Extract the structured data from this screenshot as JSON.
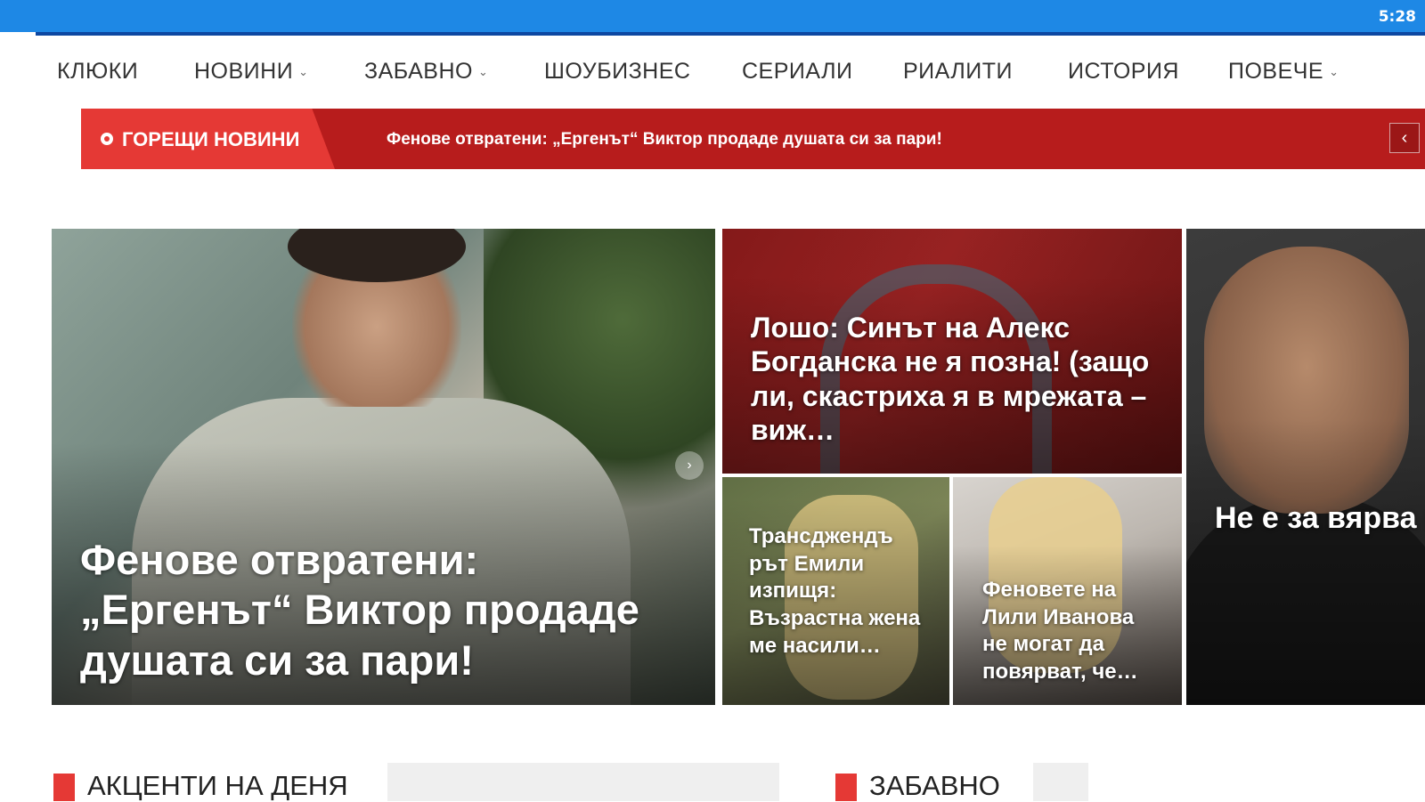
{
  "status_bar": {
    "time": "5:28",
    "color": "#1e88e5"
  },
  "nav": {
    "items": [
      {
        "label": "КЛЮКИ",
        "dropdown": false
      },
      {
        "label": "НОВИНИ",
        "dropdown": true
      },
      {
        "label": "ЗАБАВНО",
        "dropdown": true
      },
      {
        "label": "ШОУБИЗНЕС",
        "dropdown": false
      },
      {
        "label": "СЕРИАЛИ",
        "dropdown": false
      },
      {
        "label": "РИАЛИТИ",
        "dropdown": false
      },
      {
        "label": "ИСТОРИЯ",
        "dropdown": false
      },
      {
        "label": "ПОВЕЧЕ",
        "dropdown": true
      }
    ],
    "dropdown_icon": "chevron-down-icon"
  },
  "breaking": {
    "label": "ГОРЕЩИ НОВИНИ",
    "headline": "Фенове отвратени: „Ергенът“ Виктор продаде душата си за пари!",
    "prev_icon": "chevron-left-icon",
    "prev_glyph": "‹",
    "accent": "#e53935",
    "background": "#b71c1c"
  },
  "featured": {
    "main": {
      "title": "Фенове отвратени: „Ергенът“ Виктор продаде душата си за пари!",
      "slider_glyph": "›"
    },
    "top": {
      "title": "Лошо: Синът на Алекс Богданска не я позна! (защо ли, скастриха я в мрежата – виж…"
    },
    "small_1": {
      "title": "Трансджендъ рът Емили изпищя: Възрастна жена ме насили…"
    },
    "small_2": {
      "title": "Феновете на Лили Иванова не могат да повярват, че…"
    },
    "right": {
      "title": "Не е за вярва какво направ Ненчо Балабанов (ФОТО)"
    }
  },
  "sections": [
    {
      "title": "АКЦЕНТИ НА ДЕНЯ"
    },
    {
      "title": "ЗАБАВНО"
    }
  ]
}
